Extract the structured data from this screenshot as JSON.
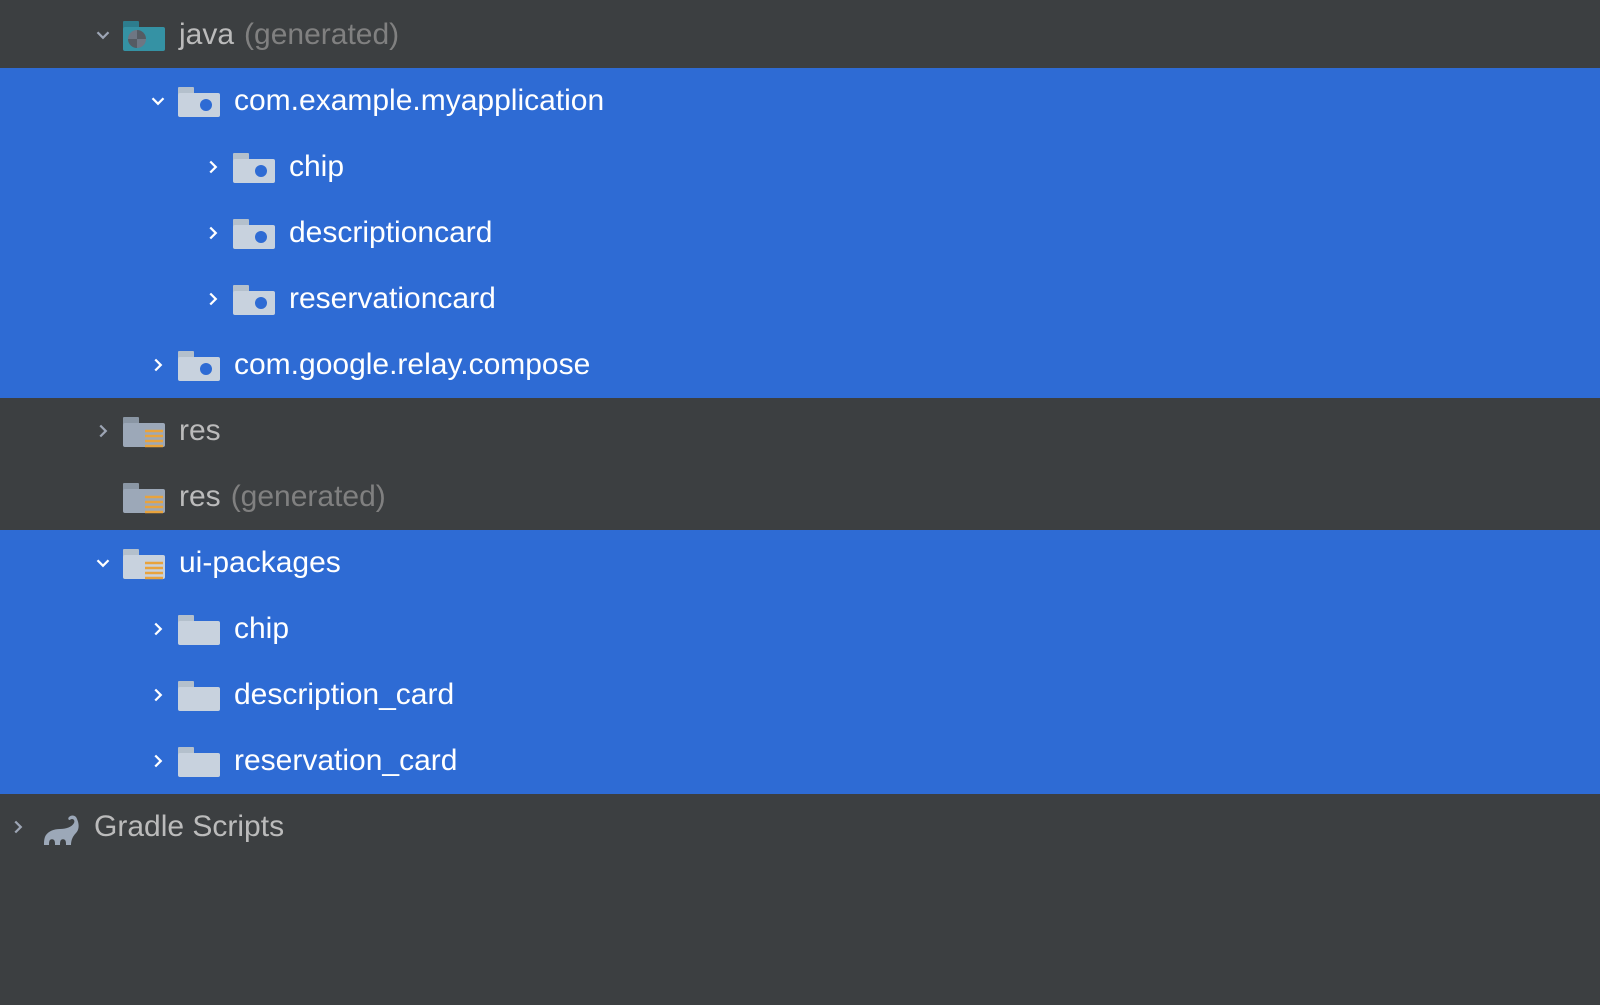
{
  "tree": {
    "java_generated": {
      "label": "java",
      "annotation": "(generated)"
    },
    "pkg_main": {
      "label": "com.example.myapplication"
    },
    "pkg_chip": {
      "label": "chip"
    },
    "pkg_descriptioncard": {
      "label": "descriptioncard"
    },
    "pkg_reservationcard": {
      "label": "reservationcard"
    },
    "pkg_relay": {
      "label": "com.google.relay.compose"
    },
    "res": {
      "label": "res"
    },
    "res_generated": {
      "label": "res",
      "annotation": "(generated)"
    },
    "ui_packages": {
      "label": "ui-packages"
    },
    "uip_chip": {
      "label": "chip"
    },
    "uip_description_card": {
      "label": "description_card"
    },
    "uip_reservation_card": {
      "label": "reservation_card"
    },
    "gradle_scripts": {
      "label": "Gradle Scripts"
    }
  }
}
